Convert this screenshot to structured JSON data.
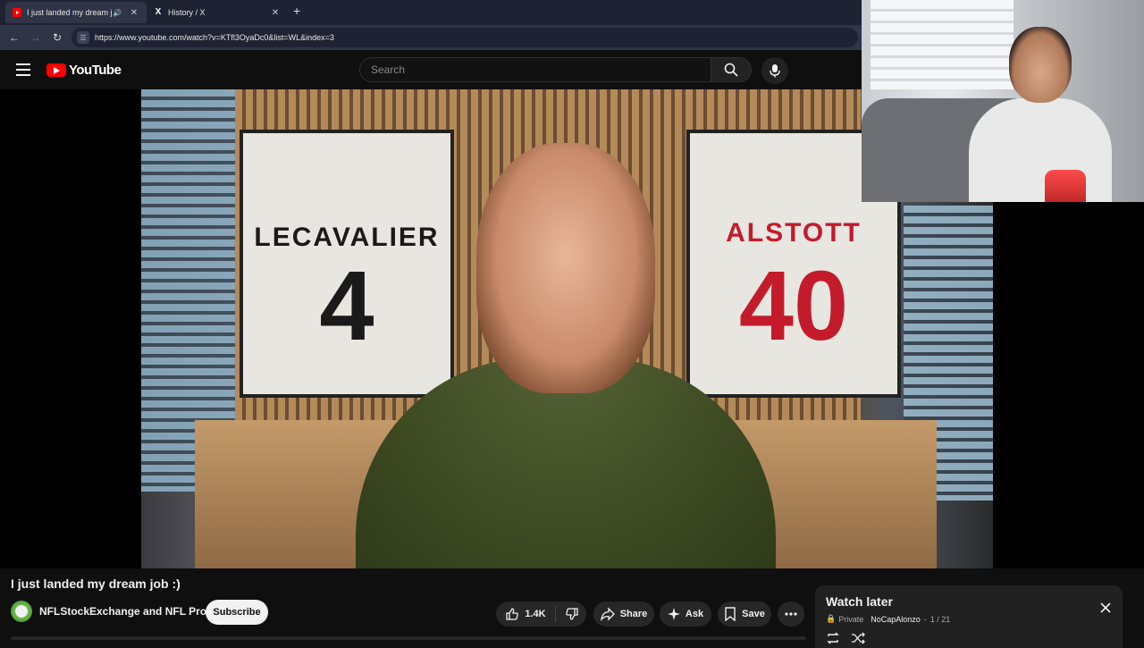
{
  "browser": {
    "tabs": [
      {
        "title": "I just landed my dream job :)",
        "active": true,
        "favicon": "youtube-icon",
        "audio": true
      },
      {
        "title": "History / X",
        "active": false,
        "favicon": "x-icon"
      }
    ],
    "url": "https://www.youtube.com/watch?v=KTfl3OyaDc0&list=WL&index=3"
  },
  "youtube": {
    "logo_text": "YouTube",
    "search_placeholder": "Search"
  },
  "video": {
    "title": "I just landed my dream job :)",
    "jersey_left_name": "LECAVALIER",
    "jersey_left_number": "4",
    "jersey_right_name": "ALSTOTT",
    "jersey_right_number": "40"
  },
  "channel": {
    "name": "NFLStockExchange and NFL Pro",
    "subscribe_label": "Subscribe"
  },
  "actions": {
    "like_count": "1.4K",
    "share_label": "Share",
    "ask_label": "Ask",
    "save_label": "Save"
  },
  "playlist": {
    "title": "Watch later",
    "privacy": "Private",
    "owner": "NoCapAlonzo",
    "position": "1 / 21"
  },
  "colors": {
    "brand_red": "#ff0000",
    "background": "#0f0f0f",
    "pill": "#272727"
  }
}
